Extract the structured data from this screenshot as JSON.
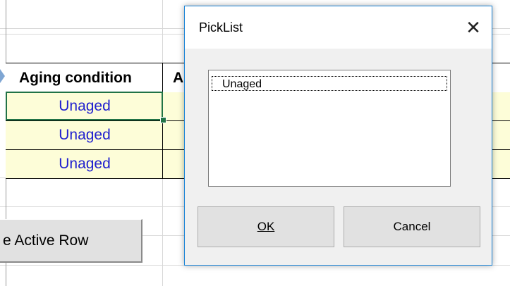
{
  "spreadsheet": {
    "header": {
      "column_1": "Aging condition",
      "column_2": "A"
    },
    "rows": [
      {
        "aging_condition": "Unaged"
      },
      {
        "aging_condition": "Unaged"
      },
      {
        "aging_condition": "Unaged"
      }
    ],
    "macro_button_label": "e Active Row"
  },
  "dialog": {
    "title": "PickList",
    "close_icon": "close-icon",
    "list_items": [
      "Unaged"
    ],
    "ok_label": "OK",
    "cancel_label": "Cancel"
  },
  "colors": {
    "dialog_border": "#1883d7",
    "cell_fill": "#fdfdd8",
    "cell_text": "#1f1fcf",
    "active_cell_border": "#217346"
  }
}
